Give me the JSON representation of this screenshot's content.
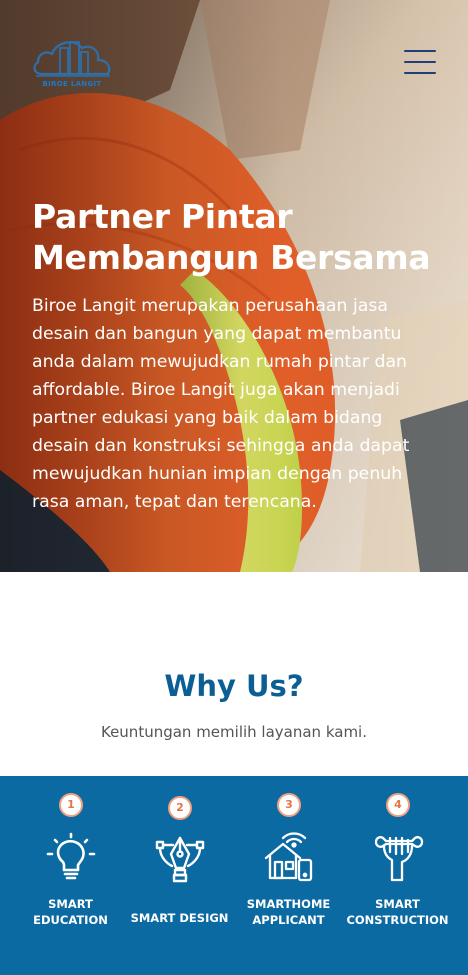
{
  "header": {
    "logo_text": "BIROE LANGIT",
    "menu_icon": "hamburger-menu-icon"
  },
  "hero": {
    "title_line1": "Partner Pintar",
    "title_line2": "Membangun Bersama",
    "description": "Biroe Langit merupakan perusahaan jasa desain dan bangun yang dapat membantu anda dalam mewujudkan rumah pintar dan affordable. Biroe Langit juga akan menjadi partner edukasi yang baik dalam bidang desain dan konstruksi sehingga anda dapat mewujudkan hunian impian dengan penuh rasa aman, tepat dan terencana."
  },
  "why": {
    "title": "Why Us?",
    "subtitle": "Keuntungan memilih layanan kami."
  },
  "features": [
    {
      "number": "1",
      "label": "SMART EDUCATION",
      "icon": "lightbulb-icon"
    },
    {
      "number": "2",
      "label": "SMART DESIGN",
      "icon": "pen-tool-icon"
    },
    {
      "number": "3",
      "label": "SMARTHOME APPLICANT",
      "icon": "smarthome-icon"
    },
    {
      "number": "4",
      "label": "SMART CONSTRUCTION",
      "icon": "wrench-hand-icon"
    }
  ],
  "colors": {
    "brand_blue": "#0c5f95",
    "band_blue": "#0c6aa3",
    "badge_accent": "#e4744a"
  }
}
